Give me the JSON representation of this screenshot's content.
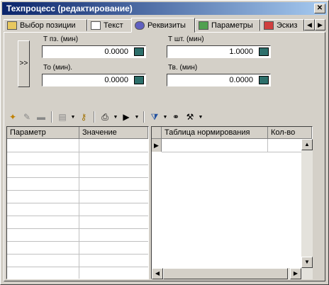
{
  "window": {
    "title": "Техпроцесс (редактирование)",
    "close_label": "✕"
  },
  "tabs": [
    {
      "label": "Выбор позиции",
      "icon": "position-icon"
    },
    {
      "label": "Текст",
      "icon": "text-icon"
    },
    {
      "label": "Реквизиты",
      "icon": "requisites-icon",
      "active": true
    },
    {
      "label": "Параметры",
      "icon": "parameters-icon"
    },
    {
      "label": "Эскиз",
      "icon": "sketch-icon"
    }
  ],
  "expand_label": ">>",
  "fields": {
    "tpz": {
      "label": "Т пз. (мин)",
      "value": "0.0000"
    },
    "tsht": {
      "label": "Т шт. (мин)",
      "value": "1.0000"
    },
    "to": {
      "label": "То (мин).",
      "value": "0.0000"
    },
    "tv": {
      "label": "Тв. (мин)",
      "value": "0.0000"
    }
  },
  "left_table": {
    "columns": [
      "Параметр",
      "Значение"
    ]
  },
  "right_table": {
    "columns": [
      "Таблица нормирования",
      "Кол-во"
    ]
  },
  "colors": {
    "title_bar": "#0a246a",
    "face": "#d4d0c8"
  }
}
